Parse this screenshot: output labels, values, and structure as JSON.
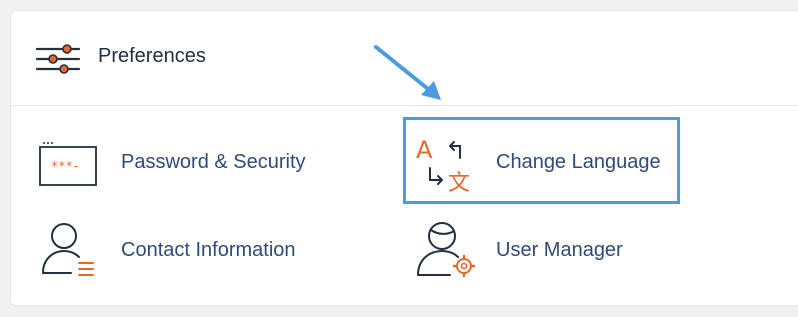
{
  "section": {
    "title": "Preferences",
    "header_icon": "sliders-icon"
  },
  "items": [
    {
      "label": "Password & Security",
      "icon": "password-icon",
      "icon_text": "***-"
    },
    {
      "label": "Change Language",
      "icon": "language-icon",
      "glyph_a": "A",
      "glyph_b": "文",
      "highlighted": true
    },
    {
      "label": "Contact Information",
      "icon": "contact-icon"
    },
    {
      "label": "User Manager",
      "icon": "user-manager-icon"
    }
  ],
  "colors": {
    "accent": "#e8672a",
    "link": "#2f4b7a",
    "highlight_border": "#4a9be0",
    "arrow": "#4a9be0"
  }
}
